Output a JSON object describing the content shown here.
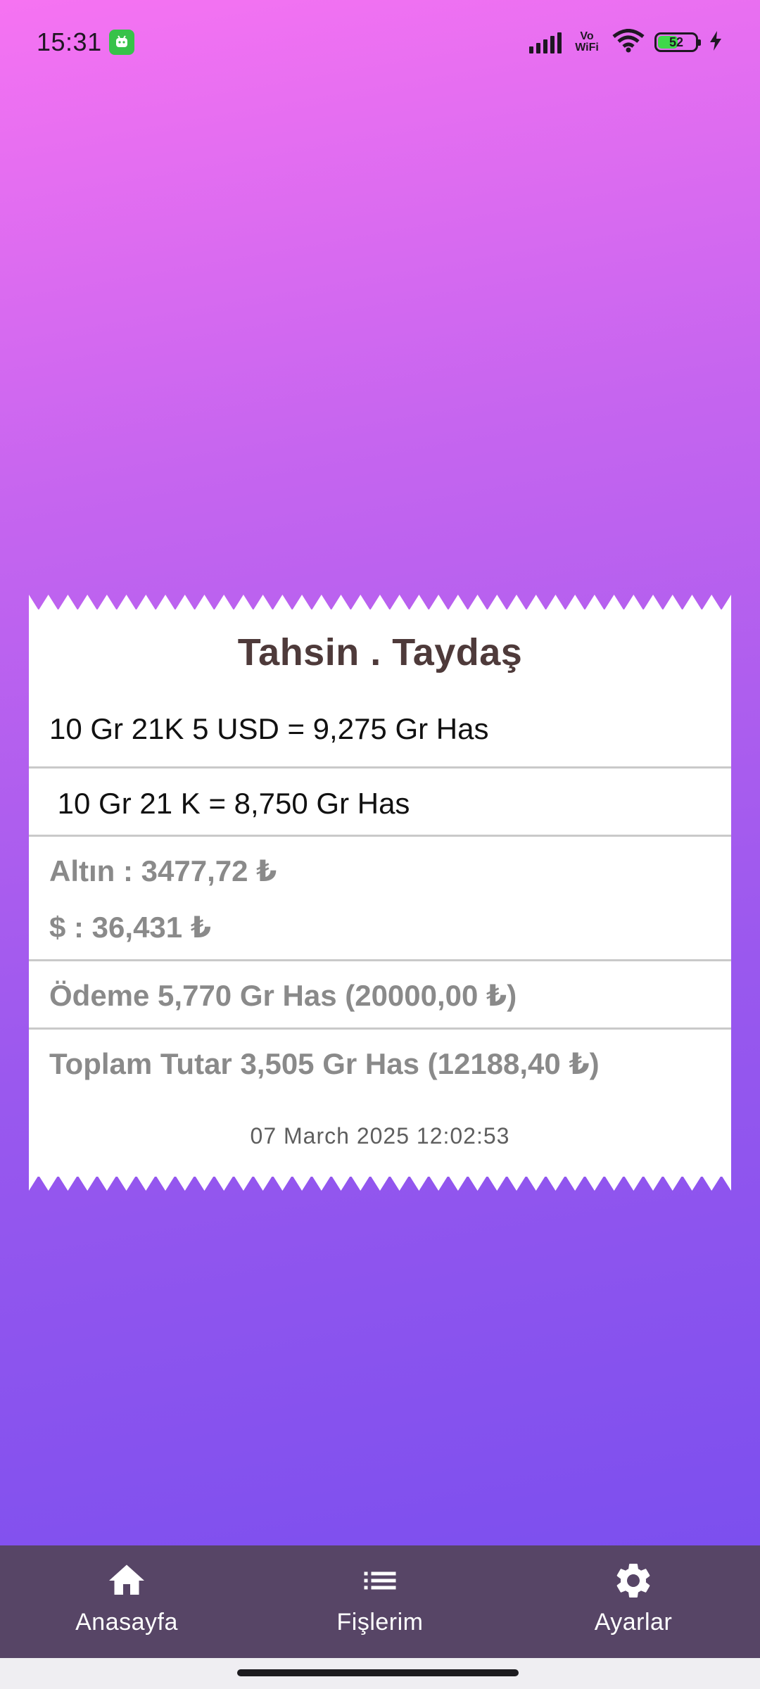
{
  "status_bar": {
    "time": "15:31",
    "network": "Vo WiFi",
    "battery_level": "52",
    "icons": [
      "android-app-icon",
      "signal-icon",
      "wifi-icon",
      "battery-icon",
      "charging-icon"
    ]
  },
  "receipt": {
    "title": "Tahsin . Taydaş",
    "line1": "10 Gr 21K 5 USD = 9,275 Gr Has",
    "line2": " 10 Gr 21 K = 8,750 Gr Has",
    "gold_rate": "Altın : 3477,72 ₺",
    "usd_rate": "$ : 36,431 ₺",
    "payment": "Ödeme 5,770 Gr Has (20000,00 ₺)",
    "total": "Toplam Tutar 3,505 Gr Has (12188,40 ₺)",
    "date": "07 March 2025 12:02:53"
  },
  "nav": {
    "items": [
      {
        "label": "Anasayfa",
        "icon": "home-icon"
      },
      {
        "label": "Fişlerim",
        "icon": "list-icon"
      },
      {
        "label": "Ayarlar",
        "icon": "gear-icon"
      }
    ]
  },
  "colors": {
    "gradient_top": "#f673f2",
    "gradient_bottom": "#7c4fee",
    "nav_bg": "#574566",
    "title": "#4e3a3a"
  }
}
